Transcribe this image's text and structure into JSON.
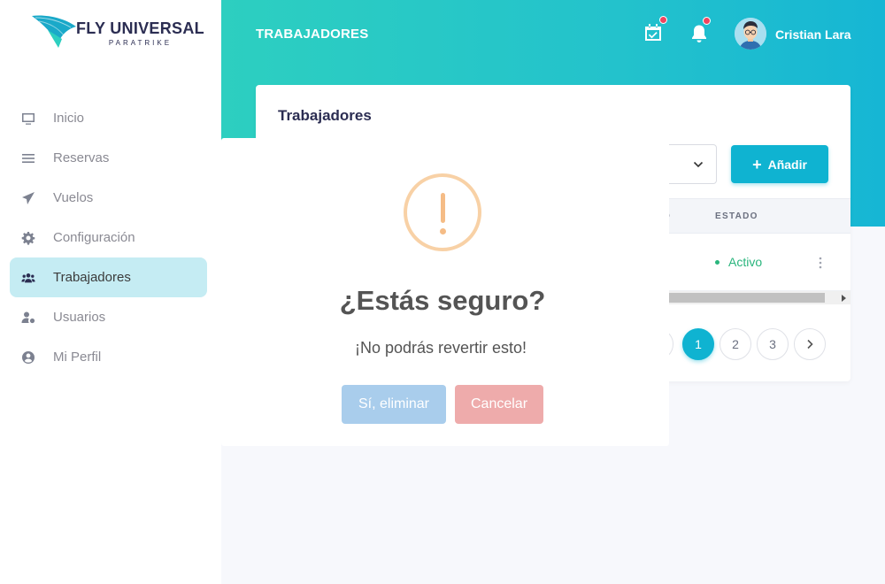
{
  "brand": {
    "title": "FLY UNIVERSAL",
    "subtitle": "PARATRIKE"
  },
  "sidebar": {
    "items": [
      {
        "label": "Inicio",
        "icon": "monitor-icon",
        "active": false
      },
      {
        "label": "Reservas",
        "icon": "menu-lines-icon",
        "active": false
      },
      {
        "label": "Vuelos",
        "icon": "paper-plane-icon",
        "active": false
      },
      {
        "label": "Configuración",
        "icon": "gear-icon",
        "active": false
      },
      {
        "label": "Trabajadores",
        "icon": "users-icon",
        "active": true
      },
      {
        "label": "Usuarios",
        "icon": "user-cog-icon",
        "active": false
      },
      {
        "label": "Mi Perfil",
        "icon": "user-circle-icon",
        "active": false
      }
    ]
  },
  "header": {
    "page_title": "TRABAJADORES",
    "user_name": "Cristian Lara",
    "icons": [
      "calendar-check-icon",
      "bell-icon"
    ]
  },
  "card": {
    "title": "Trabajadores",
    "add_button": "Añadir",
    "columns": {
      "partial": "O",
      "estado": "ESTADO"
    },
    "row": {
      "status": "Activo"
    },
    "pagination": [
      "1",
      "2",
      "3"
    ],
    "current_page": "1"
  },
  "modal": {
    "title": "¿Estás seguro?",
    "text": "¡No podrás revertir esto!",
    "confirm": "Sí, eliminar",
    "cancel": "Cancelar"
  },
  "colors": {
    "accent": "#0fb3d1",
    "header_gradient_start": "#2dcfc0",
    "header_gradient_end": "#16b6d4",
    "active_nav": "#c5ecf3",
    "status_active": "#2ab57d",
    "warning": "#f8d1a6",
    "confirm_button": "#a9cdec",
    "cancel_button": "#eeabab"
  }
}
